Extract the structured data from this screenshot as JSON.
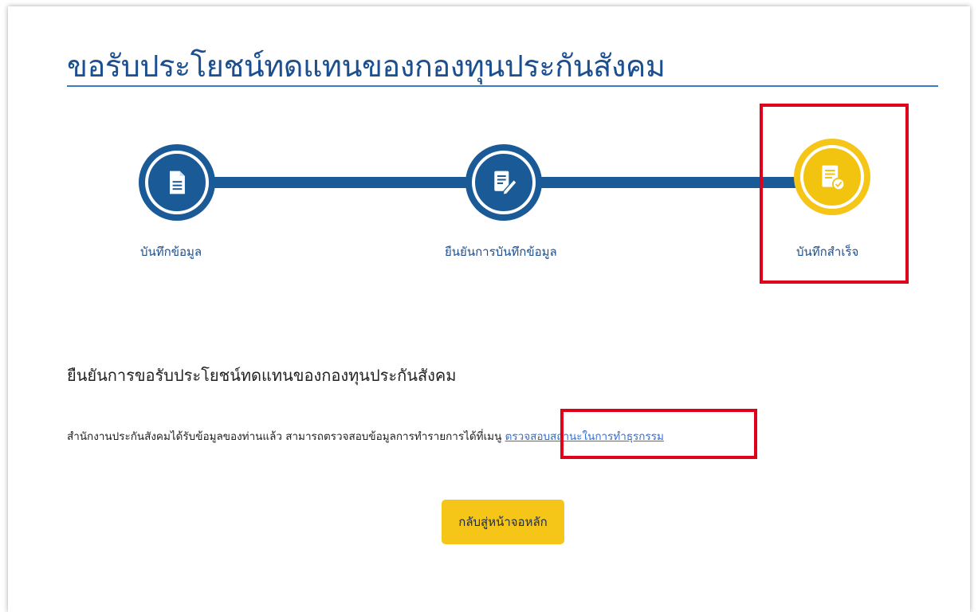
{
  "page": {
    "title": "ขอรับประโยชน์ทดแทนของกองทุนประกันสังคม"
  },
  "steps": [
    {
      "label": "บันทึกข้อมูล",
      "icon": "document-icon",
      "state": "completed"
    },
    {
      "label": "ยืนยันการบันทึกข้อมูล",
      "icon": "edit-document-icon",
      "state": "completed"
    },
    {
      "label": "บันทึกสำเร็จ",
      "icon": "document-check-icon",
      "state": "current"
    }
  ],
  "confirmation": {
    "heading": "ยืนยันการขอรับประโยชน์ทดแทนของกองทุนประกันสังคม",
    "message": "สำนักงานประกันสังคมได้รับข้อมูลของท่านแล้ว สามารถตรวจสอบข้อมูลการทำรายการได้ที่เมนู ",
    "link_label": "ตรวจสอบสถานะในการทำธุรกรรม"
  },
  "actions": {
    "home_label": "กลับสู่หน้าจอหลัก"
  },
  "colors": {
    "primary": "#1a5a96",
    "accent": "#f5c518",
    "highlight": "#e1001a",
    "link": "#2f6fd6"
  }
}
